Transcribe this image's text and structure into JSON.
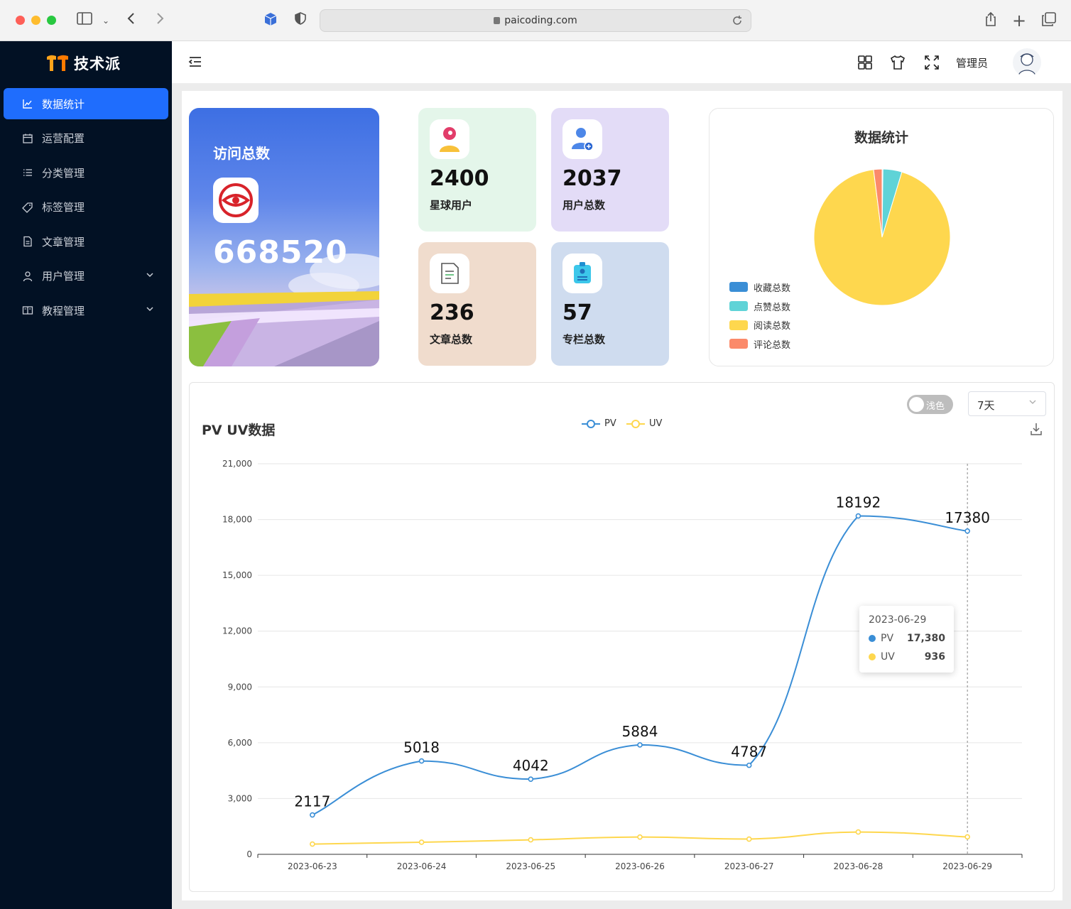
{
  "browser": {
    "url": "paicoding.com"
  },
  "sidebar": {
    "logo_text": "技术派",
    "items": [
      {
        "label": "数据统计",
        "icon": "chart-line-icon",
        "active": true
      },
      {
        "label": "运营配置",
        "icon": "calendar-icon"
      },
      {
        "label": "分类管理",
        "icon": "list-icon"
      },
      {
        "label": "标签管理",
        "icon": "tag-icon"
      },
      {
        "label": "文章管理",
        "icon": "document-icon"
      },
      {
        "label": "用户管理",
        "icon": "user-icon",
        "has_submenu": true
      },
      {
        "label": "教程管理",
        "icon": "book-icon",
        "has_submenu": true
      }
    ]
  },
  "header": {
    "admin_name": "管理员"
  },
  "visit_card": {
    "title": "访问总数",
    "value": "668520"
  },
  "stats": [
    {
      "value": "2400",
      "label": "星球用户",
      "bg": "#e4f6ea"
    },
    {
      "value": "2037",
      "label": "用户总数",
      "bg": "#e3dcf7"
    },
    {
      "value": "236",
      "label": "文章总数",
      "bg": "#f0dccd"
    },
    {
      "value": "57",
      "label": "专栏总数",
      "bg": "#cfdcef"
    }
  ],
  "pie": {
    "title": "数据统计",
    "legend": [
      {
        "label": "收藏总数",
        "color": "#3a8ed6"
      },
      {
        "label": "点赞总数",
        "color": "#5fd3d7"
      },
      {
        "label": "阅读总数",
        "color": "#fed74e"
      },
      {
        "label": "评论总数",
        "color": "#fb8a6a"
      }
    ]
  },
  "line_chart_card": {
    "title": "PV UV数据",
    "toggle_label": "浅色",
    "range_select": "7天"
  },
  "tooltip": {
    "date": "2023-06-29",
    "rows": [
      {
        "name": "PV",
        "value": "17,380",
        "color": "#3a8ed6"
      },
      {
        "name": "UV",
        "value": "936",
        "color": "#fed74e"
      }
    ]
  },
  "chart_data": [
    {
      "type": "pie",
      "title": "数据统计",
      "categories": [
        "收藏总数",
        "点赞总数",
        "阅读总数",
        "评论总数"
      ],
      "values": [
        0.2,
        4.5,
        93.3,
        2.0
      ],
      "legend_position": "left-bottom"
    },
    {
      "type": "line",
      "title": "PV UV数据",
      "categories": [
        "2023-06-23",
        "2023-06-24",
        "2023-06-25",
        "2023-06-26",
        "2023-06-27",
        "2023-06-28",
        "2023-06-29"
      ],
      "series": [
        {
          "name": "PV",
          "color": "#3a8ed6",
          "values": [
            2117,
            5018,
            4042,
            5884,
            4787,
            18192,
            17380
          ],
          "data_labels": [
            "2117",
            "5018",
            "4042",
            "5884",
            "4787",
            "18192",
            "17380"
          ]
        },
        {
          "name": "UV",
          "color": "#fed74e",
          "values": [
            550,
            650,
            780,
            930,
            820,
            1200,
            936
          ]
        }
      ],
      "y_ticks": [
        "0",
        "3,000",
        "6,000",
        "9,000",
        "12,000",
        "15,000",
        "18,000",
        "21,000"
      ],
      "ylim": [
        0,
        21000
      ],
      "grid": true,
      "legend_position": "top-center",
      "smooth": true
    }
  ]
}
